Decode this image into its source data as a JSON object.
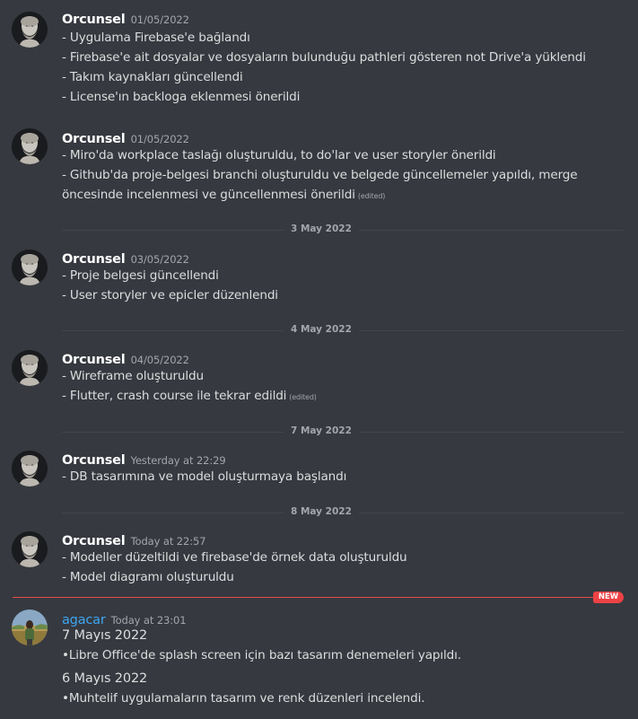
{
  "messages": [
    {
      "username": "Orcunsel",
      "timestamp": "01/05/2022",
      "lines": [
        "- Uygulama Firebase'e bağlandı",
        "- Firebase'e ait dosyalar ve dosyaların bulunduğu pathleri gösteren not Drive'a yüklendi",
        "- Takım kaynakları güncellendi",
        "- License'ın backloga eklenmesi önerildi"
      ]
    },
    {
      "username": "Orcunsel",
      "timestamp": "01/05/2022",
      "lines": [
        "- Miro'da workplace taslağı oluşturuldu, to do'lar ve user storyler önerildi",
        "- Github'da proje-belgesi branchi oluşturuldu ve belgede güncellemeler yapıldı, merge",
        "öncesinde incelenmesi ve güncellenmesi önerildi"
      ],
      "edited": "(edited)"
    },
    {
      "username": "Orcunsel",
      "timestamp": "03/05/2022",
      "lines": [
        "- Proje belgesi güncellendi",
        "- User storyler ve epicler düzenlendi"
      ]
    },
    {
      "username": "Orcunsel",
      "timestamp": "04/05/2022",
      "lines": [
        "- Wireframe oluşturuldu",
        "- Flutter, crash course ile tekrar edildi"
      ],
      "edited": "(edited)"
    },
    {
      "username": "Orcunsel",
      "timestamp": "Yesterday at 22:29",
      "lines": [
        "- DB tasarımına ve model oluşturmaya başlandı"
      ]
    },
    {
      "username": "Orcunsel",
      "timestamp": "Today at 22:57",
      "lines": [
        "- Modeller düzeltildi ve firebase'de örnek data oluşturuldu",
        "- Model diagramı oluşturuldu"
      ]
    },
    {
      "username": "agacar",
      "timestamp": "Today at 23:01",
      "lines": [
        "7 Mayıs 2022",
        "•Libre Office'de splash screen için bazı tasarım denemeleri yapıldı.",
        "6 Mayıs 2022",
        "•Muhtelif uygulamaların tasarım ve renk düzenleri incelendi."
      ]
    }
  ],
  "dividers": [
    "3 May 2022",
    "4 May 2022",
    "7 May 2022",
    "8 May 2022"
  ],
  "new_badge": "NEW",
  "colors": {
    "background": "#36393f",
    "text": "#dcddde",
    "username": "#ffffff",
    "username_agacar": "#3ea6f2",
    "timestamp": "#a3a6aa",
    "new_marker": "#ed4245"
  },
  "icons": {
    "orcunsel_avatar": "marble-bust-avatar",
    "agacar_avatar": "outdoor-photo-avatar"
  }
}
